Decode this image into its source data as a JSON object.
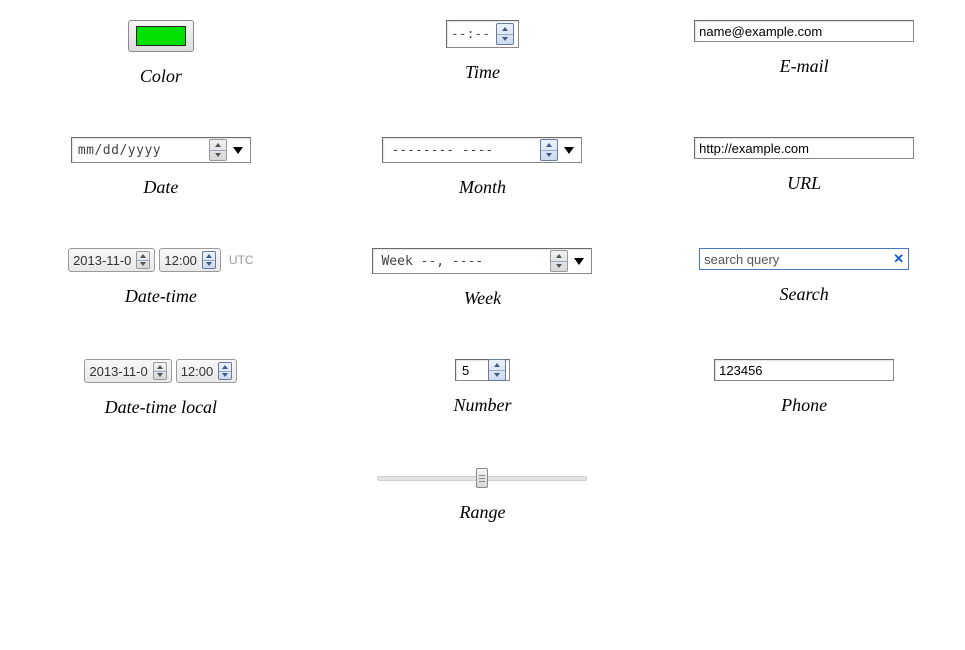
{
  "color": {
    "label": "Color",
    "value": "#00e000"
  },
  "time": {
    "label": "Time",
    "value": "--:--"
  },
  "email": {
    "label": "E-mail",
    "value": "name@example.com"
  },
  "date": {
    "label": "Date",
    "value": "mm/dd/yyyy"
  },
  "month": {
    "label": "Month",
    "value": "-------- ----"
  },
  "url": {
    "label": "URL",
    "value": "http://example.com"
  },
  "datetime": {
    "label": "Date-time",
    "date": "2013-11-0",
    "time": "12:00",
    "tz": "UTC"
  },
  "week": {
    "label": "Week",
    "value": "Week --, ----"
  },
  "search": {
    "label": "Search",
    "value": "search query"
  },
  "datetime_local": {
    "label": "Date-time local",
    "date": "2013-11-0",
    "time": "12:00"
  },
  "number": {
    "label": "Number",
    "value": "5"
  },
  "phone": {
    "label": "Phone",
    "value": "123456"
  },
  "range": {
    "label": "Range"
  }
}
